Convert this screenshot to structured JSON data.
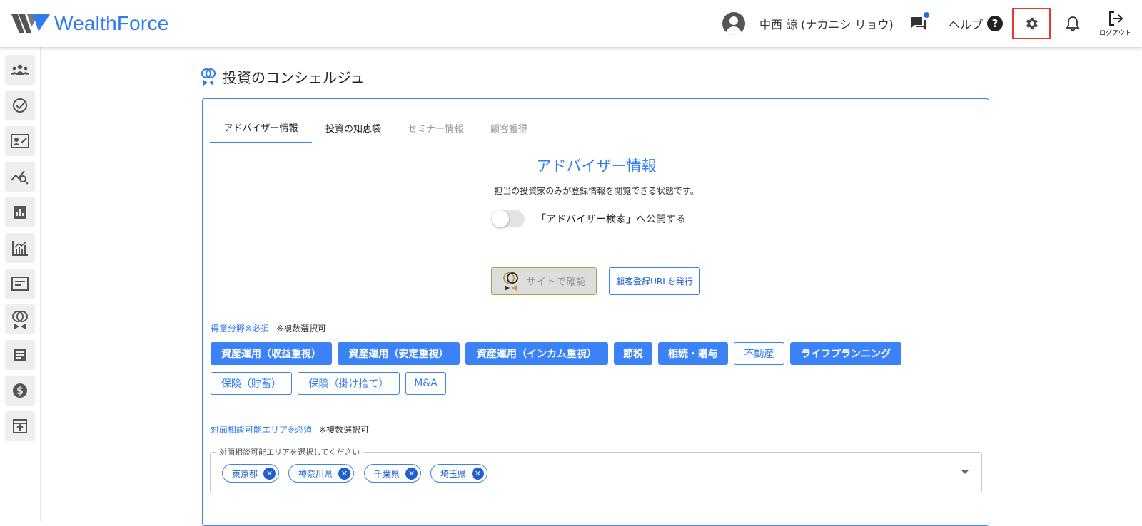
{
  "header": {
    "logo_wealth": "Wealth",
    "logo_force": "Force",
    "username": "中西 諒 (ナカニシ リョウ)",
    "help_label": "ヘルプ",
    "help_icon_glyph": "?",
    "logout_label": "ログアウト"
  },
  "sidebar": {
    "items": [
      {
        "icon": "clients-icon"
      },
      {
        "icon": "task-check-icon"
      },
      {
        "icon": "profile-card-icon"
      },
      {
        "icon": "analytics-search-icon"
      },
      {
        "icon": "bar-report-icon"
      },
      {
        "icon": "growth-chart-icon"
      },
      {
        "icon": "web-page-icon"
      },
      {
        "icon": "concierge-icon"
      },
      {
        "icon": "document-icon"
      },
      {
        "icon": "dollar-icon"
      },
      {
        "icon": "publish-icon"
      }
    ]
  },
  "page": {
    "title": "投資のコンシェルジュ"
  },
  "tabs": [
    {
      "label": "アドバイザー情報",
      "state": "active"
    },
    {
      "label": "投資の知恵袋",
      "state": "normal"
    },
    {
      "label": "セミナー情報",
      "state": "disabled"
    },
    {
      "label": "顧客獲得",
      "state": "disabled"
    }
  ],
  "advisor": {
    "section_title": "アドバイザー情報",
    "subtitle": "担当の投資家のみが登録情報を閲覧できる状態です。",
    "toggle_label": "「アドバイザー検索」へ公開する",
    "toggle_on": false,
    "site_button": "サイトで確認",
    "url_button": "顧客登録URLを発行"
  },
  "specialty": {
    "label": "得意分野※必須",
    "note": "※複数選択可",
    "options": [
      {
        "label": "資産運用（収益重視）",
        "selected": true
      },
      {
        "label": "資産運用（安定重視）",
        "selected": true
      },
      {
        "label": "資産運用（インカム重視）",
        "selected": true
      },
      {
        "label": "節税",
        "selected": true
      },
      {
        "label": "相続・贈与",
        "selected": true
      },
      {
        "label": "不動産",
        "selected": false
      },
      {
        "label": "ライフプランニング",
        "selected": true
      },
      {
        "label": "保険（貯蓄）",
        "selected": false
      },
      {
        "label": "保険（掛け捨て）",
        "selected": false
      },
      {
        "label": "M&A",
        "selected": false
      }
    ]
  },
  "area": {
    "label": "対面相談可能エリア※必須",
    "note": "※複数選択可",
    "placeholder": "対面相談可能エリアを選択してください",
    "selected": [
      "東京都",
      "神奈川県",
      "千葉県",
      "埼玉県"
    ],
    "remove_glyph": "✕"
  },
  "colors": {
    "accent": "#3b82f6",
    "highlight_border": "#e53935"
  }
}
